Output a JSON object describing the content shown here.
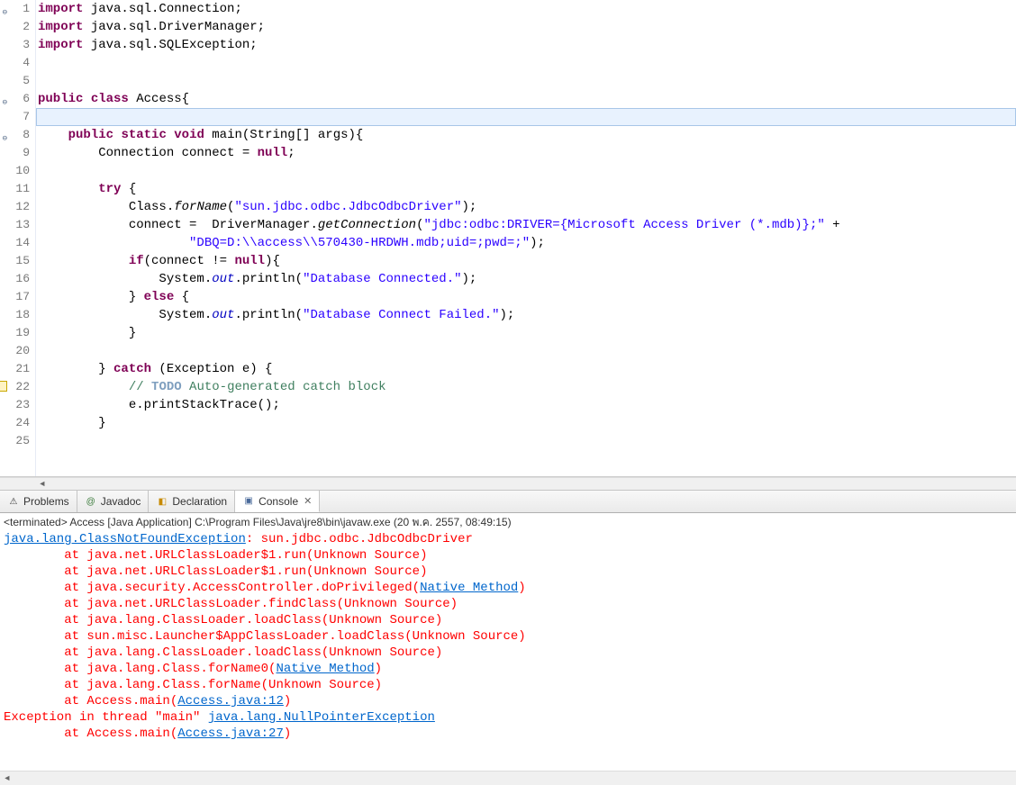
{
  "editor": {
    "lines": [
      {
        "n": 1,
        "fold": "minus",
        "tokens": [
          {
            "t": "kw",
            "v": "import"
          },
          {
            "t": "plain",
            "v": " java.sql.Connection;"
          }
        ]
      },
      {
        "n": 2,
        "tokens": [
          {
            "t": "kw",
            "v": "import"
          },
          {
            "t": "plain",
            "v": " java.sql.DriverManager;"
          }
        ]
      },
      {
        "n": 3,
        "tokens": [
          {
            "t": "kw",
            "v": "import"
          },
          {
            "t": "plain",
            "v": " java.sql.SQLException;"
          }
        ]
      },
      {
        "n": 4,
        "tokens": []
      },
      {
        "n": 5,
        "tokens": []
      },
      {
        "n": 6,
        "fold": "minus",
        "tokens": [
          {
            "t": "kw",
            "v": "public"
          },
          {
            "t": "plain",
            "v": " "
          },
          {
            "t": "kw",
            "v": "class"
          },
          {
            "t": "plain",
            "v": " Access{"
          }
        ]
      },
      {
        "n": 7,
        "highlight": true,
        "tokens": []
      },
      {
        "n": 8,
        "fold": "minus",
        "tokens": [
          {
            "t": "plain",
            "v": "    "
          },
          {
            "t": "kw",
            "v": "public"
          },
          {
            "t": "plain",
            "v": " "
          },
          {
            "t": "kw",
            "v": "static"
          },
          {
            "t": "plain",
            "v": " "
          },
          {
            "t": "kw",
            "v": "void"
          },
          {
            "t": "plain",
            "v": " main(String[] args){"
          }
        ]
      },
      {
        "n": 9,
        "tokens": [
          {
            "t": "plain",
            "v": "        Connection connect = "
          },
          {
            "t": "kw",
            "v": "null"
          },
          {
            "t": "plain",
            "v": ";"
          }
        ]
      },
      {
        "n": 10,
        "tokens": []
      },
      {
        "n": 11,
        "tokens": [
          {
            "t": "plain",
            "v": "        "
          },
          {
            "t": "kw",
            "v": "try"
          },
          {
            "t": "plain",
            "v": " {"
          }
        ]
      },
      {
        "n": 12,
        "tokens": [
          {
            "t": "plain",
            "v": "            Class."
          },
          {
            "t": "method-italic",
            "v": "forName"
          },
          {
            "t": "plain",
            "v": "("
          },
          {
            "t": "str",
            "v": "\"sun.jdbc.odbc.JdbcOdbcDriver\""
          },
          {
            "t": "plain",
            "v": ");"
          }
        ]
      },
      {
        "n": 13,
        "tokens": [
          {
            "t": "plain",
            "v": "            connect =  DriverManager."
          },
          {
            "t": "method-italic",
            "v": "getConnection"
          },
          {
            "t": "plain",
            "v": "("
          },
          {
            "t": "str",
            "v": "\"jdbc:odbc:DRIVER={Microsoft Access Driver (*.mdb)};\""
          },
          {
            "t": "plain",
            "v": " +"
          }
        ]
      },
      {
        "n": 14,
        "tokens": [
          {
            "t": "plain",
            "v": "                    "
          },
          {
            "t": "str",
            "v": "\"DBQ=D:\\\\access\\\\570430-HRDWH.mdb;uid=;pwd=;\""
          },
          {
            "t": "plain",
            "v": ");"
          }
        ]
      },
      {
        "n": 15,
        "tokens": [
          {
            "t": "plain",
            "v": "            "
          },
          {
            "t": "kw",
            "v": "if"
          },
          {
            "t": "plain",
            "v": "(connect != "
          },
          {
            "t": "kw",
            "v": "null"
          },
          {
            "t": "plain",
            "v": "){"
          }
        ]
      },
      {
        "n": 16,
        "tokens": [
          {
            "t": "plain",
            "v": "                System."
          },
          {
            "t": "static-field",
            "v": "out"
          },
          {
            "t": "plain",
            "v": ".println("
          },
          {
            "t": "str",
            "v": "\"Database Connected.\""
          },
          {
            "t": "plain",
            "v": ");"
          }
        ]
      },
      {
        "n": 17,
        "tokens": [
          {
            "t": "plain",
            "v": "            } "
          },
          {
            "t": "kw",
            "v": "else"
          },
          {
            "t": "plain",
            "v": " {"
          }
        ]
      },
      {
        "n": 18,
        "tokens": [
          {
            "t": "plain",
            "v": "                System."
          },
          {
            "t": "static-field",
            "v": "out"
          },
          {
            "t": "plain",
            "v": ".println("
          },
          {
            "t": "str",
            "v": "\"Database Connect Failed.\""
          },
          {
            "t": "plain",
            "v": ");"
          }
        ]
      },
      {
        "n": 19,
        "tokens": [
          {
            "t": "plain",
            "v": "            }"
          }
        ]
      },
      {
        "n": 20,
        "tokens": []
      },
      {
        "n": 21,
        "tokens": [
          {
            "t": "plain",
            "v": "        } "
          },
          {
            "t": "kw",
            "v": "catch"
          },
          {
            "t": "plain",
            "v": " (Exception e) {"
          }
        ]
      },
      {
        "n": 22,
        "warn": true,
        "tokens": [
          {
            "t": "plain",
            "v": "            "
          },
          {
            "t": "com",
            "v": "// "
          },
          {
            "t": "com-tag",
            "v": "TODO"
          },
          {
            "t": "com",
            "v": " Auto-generated catch block"
          }
        ]
      },
      {
        "n": 23,
        "tokens": [
          {
            "t": "plain",
            "v": "            e.printStackTrace();"
          }
        ]
      },
      {
        "n": 24,
        "tokens": [
          {
            "t": "plain",
            "v": "        }"
          }
        ]
      },
      {
        "n": 25,
        "tokens": []
      }
    ]
  },
  "tabs": {
    "problems": "Problems",
    "javadoc": "Javadoc",
    "declaration": "Declaration",
    "console": "Console"
  },
  "console": {
    "header": "<terminated> Access [Java Application] C:\\Program Files\\Java\\jre8\\bin\\javaw.exe (20 พ.ค. 2557, 08:49:15)",
    "lines": [
      {
        "segs": [
          {
            "t": "con-link",
            "v": "java.lang.ClassNotFoundException"
          },
          {
            "t": "con-red",
            "v": ": sun.jdbc.odbc.JdbcOdbcDriver"
          }
        ]
      },
      {
        "segs": [
          {
            "t": "con-red",
            "v": "        at java.net.URLClassLoader$1.run(Unknown Source)"
          }
        ]
      },
      {
        "segs": [
          {
            "t": "con-red",
            "v": "        at java.net.URLClassLoader$1.run(Unknown Source)"
          }
        ]
      },
      {
        "segs": [
          {
            "t": "con-red",
            "v": "        at java.security.AccessController.doPrivileged("
          },
          {
            "t": "con-link",
            "v": "Native Method"
          },
          {
            "t": "con-red",
            "v": ")"
          }
        ]
      },
      {
        "segs": [
          {
            "t": "con-red",
            "v": "        at java.net.URLClassLoader.findClass(Unknown Source)"
          }
        ]
      },
      {
        "segs": [
          {
            "t": "con-red",
            "v": "        at java.lang.ClassLoader.loadClass(Unknown Source)"
          }
        ]
      },
      {
        "segs": [
          {
            "t": "con-red",
            "v": "        at sun.misc.Launcher$AppClassLoader.loadClass(Unknown Source)"
          }
        ]
      },
      {
        "segs": [
          {
            "t": "con-red",
            "v": "        at java.lang.ClassLoader.loadClass(Unknown Source)"
          }
        ]
      },
      {
        "segs": [
          {
            "t": "con-red",
            "v": "        at java.lang.Class.forName0("
          },
          {
            "t": "con-link",
            "v": "Native Method"
          },
          {
            "t": "con-red",
            "v": ")"
          }
        ]
      },
      {
        "segs": [
          {
            "t": "con-red",
            "v": "        at java.lang.Class.forName(Unknown Source)"
          }
        ]
      },
      {
        "segs": [
          {
            "t": "con-red",
            "v": "        at Access.main("
          },
          {
            "t": "con-link",
            "v": "Access.java:12"
          },
          {
            "t": "con-red",
            "v": ")"
          }
        ]
      },
      {
        "segs": [
          {
            "t": "con-red",
            "v": "Exception in thread \"main\" "
          },
          {
            "t": "con-link",
            "v": "java.lang.NullPointerException"
          }
        ]
      },
      {
        "segs": [
          {
            "t": "con-red",
            "v": "        at Access.main("
          },
          {
            "t": "con-link",
            "v": "Access.java:27"
          },
          {
            "t": "con-red",
            "v": ")"
          }
        ]
      }
    ]
  }
}
